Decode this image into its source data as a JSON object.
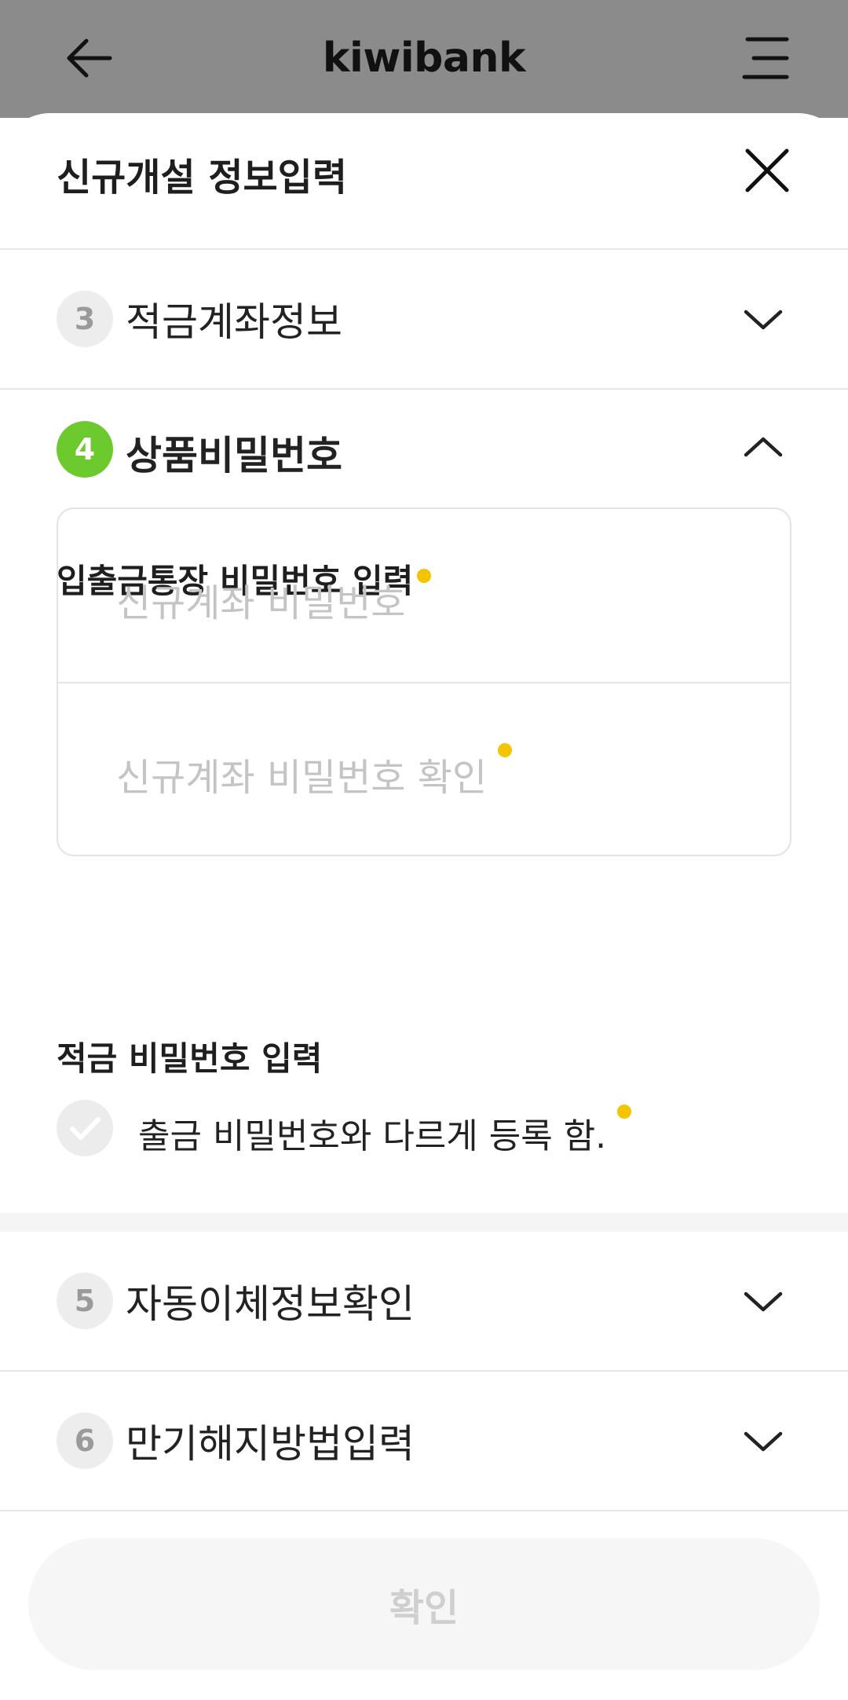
{
  "app_header": {
    "title": "kiwibank",
    "back_icon": "arrow-left-icon",
    "menu_icon": "menu-icon"
  },
  "sheet": {
    "title": "신규개설 정보입력",
    "close_icon": "close-icon"
  },
  "steps": [
    {
      "number": "3",
      "label": "적금계좌정보",
      "expanded": false
    },
    {
      "number": "4",
      "label": "상품비밀번호",
      "expanded": true
    },
    {
      "number": "5",
      "label": "자동이체정보확인",
      "expanded": false
    },
    {
      "number": "6",
      "label": "만기해지방법입력",
      "expanded": false
    }
  ],
  "password_section": {
    "deposit_heading": "입출금통장 비밀번호 입력",
    "new_password_placeholder": "신규계좌 비밀번호",
    "confirm_password_placeholder": "신규계좌 비밀번호 확인",
    "savings_heading": "적금 비밀번호 입력",
    "different_checkbox_label": "출금 비밀번호와 다르게 등록 함."
  },
  "footer": {
    "confirm_label": "확인"
  },
  "colors": {
    "accent_green": "#6cc92e",
    "required_dot": "#f5c400",
    "dim_header": "#8b8b8b"
  }
}
